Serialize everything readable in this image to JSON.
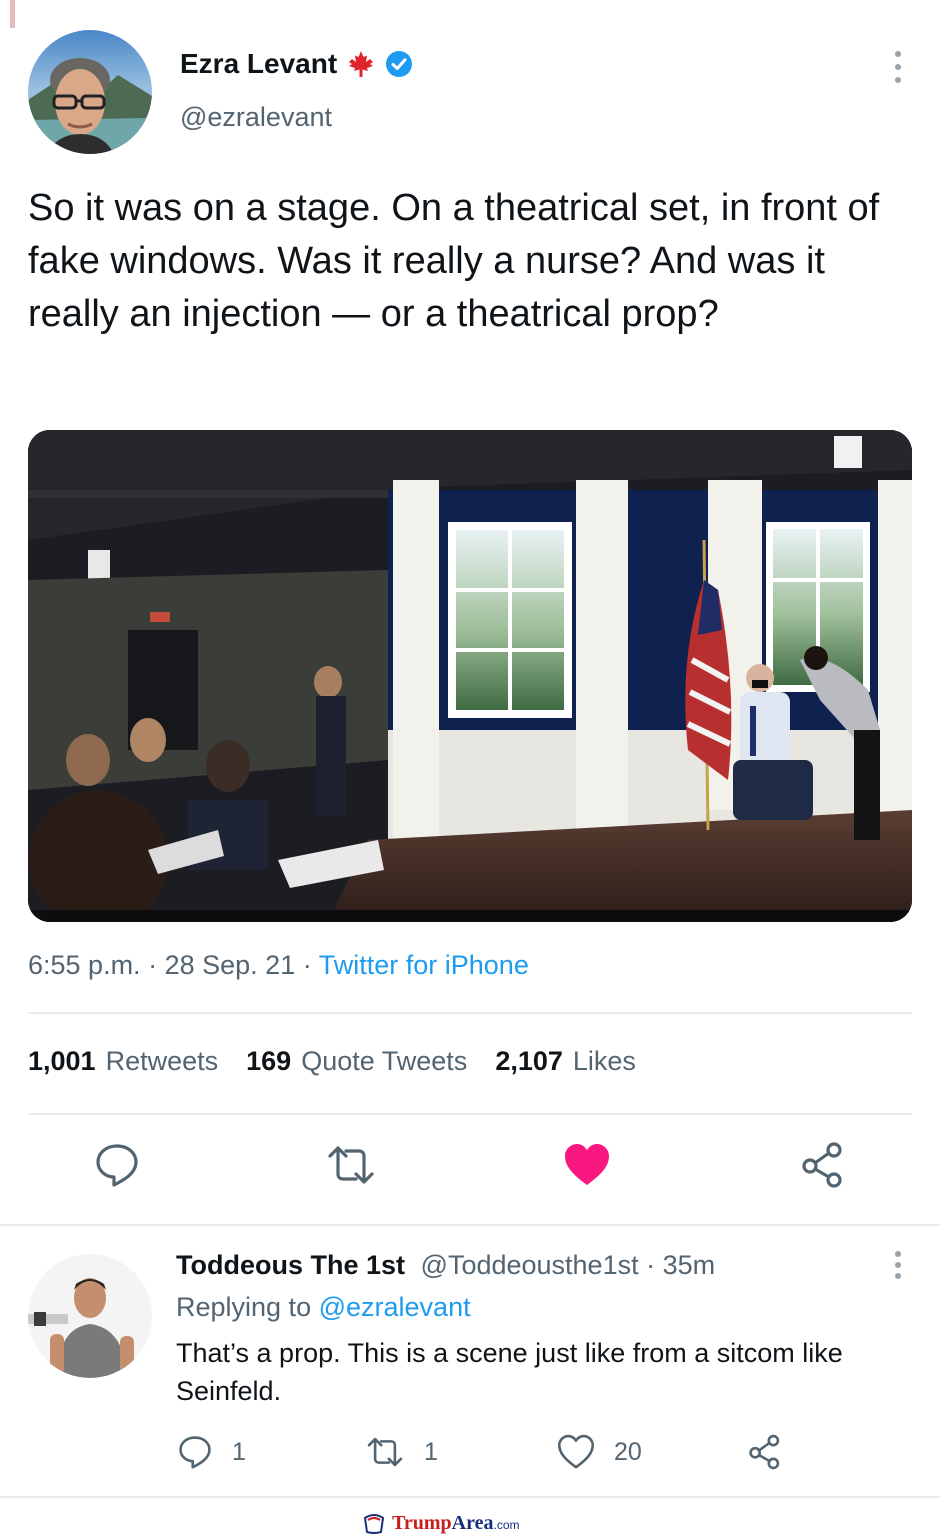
{
  "tweet": {
    "author": {
      "name": "Ezra Levant",
      "handle": "@ezralevant",
      "verified": true,
      "flag_icon": "maple-leaf-icon",
      "verified_icon": "verified-badge-icon"
    },
    "text": "So it was on a stage. On a theatrical set, in front of fake windows. Was it really a nurse? And was it really an injection — or a theatrical prop?",
    "meta": {
      "time": "6:55 p.m.",
      "date": "28 Sep. 21",
      "separator": "·",
      "source": "Twitter for iPhone"
    },
    "stats": {
      "retweets_count": "1,001",
      "retweets_label": "Retweets",
      "quotes_count": "169",
      "quotes_label": "Quote Tweets",
      "likes_count": "2,107",
      "likes_label": "Likes"
    },
    "actions": [
      "reply-icon",
      "retweet-icon",
      "heart-filled-icon",
      "share-icon"
    ]
  },
  "reply": {
    "name": "Toddeous The 1st",
    "handle": "@Toddeousthe1st",
    "separator": "·",
    "time": "35m",
    "replying_label": "Replying to",
    "replying_to": "@ezralevant",
    "text": "That’s a prop.  This is a scene just like from a sitcom like Seinfeld.",
    "counts": {
      "replies": "1",
      "retweets": "1",
      "likes": "20"
    }
  },
  "watermark": {
    "part1": "Trump",
    "part2": "Area",
    "part3": ".com"
  },
  "colors": {
    "link": "#1d9bf0",
    "secondary_text": "#536471",
    "like_red": "#f91880",
    "verified_blue": "#1d9bf0",
    "maple_red": "#e0242b"
  }
}
